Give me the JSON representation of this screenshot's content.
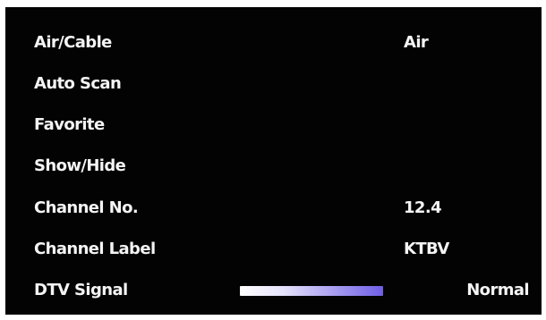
{
  "menu": {
    "air_cable": {
      "label": "Air/Cable",
      "value": "Air"
    },
    "auto_scan": {
      "label": "Auto Scan"
    },
    "favorite": {
      "label": "Favorite"
    },
    "show_hide": {
      "label": "Show/Hide"
    },
    "channel_no": {
      "label": "Channel No.",
      "value": "12.4"
    },
    "channel_label": {
      "label": "Channel Label",
      "value": "KTBV"
    },
    "dtv_signal": {
      "label": "DTV Signal",
      "value": "Normal",
      "level_percent": 100
    }
  },
  "colors": {
    "background": "#030303",
    "text": "#f4f4f4",
    "signal_start": "#ffffff",
    "signal_end": "#6f5fe6"
  }
}
